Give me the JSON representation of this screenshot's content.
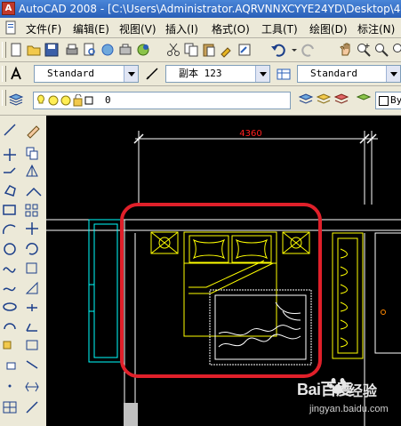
{
  "window": {
    "title": "AutoCAD 2008 - [C:\\Users\\Administrator.AQRVNNXCYYE24YD\\Desktop\\4-"
  },
  "menu": {
    "items": [
      "文件(F)",
      "编辑(E)",
      "视图(V)",
      "插入(I)",
      "格式(O)",
      "工具(T)",
      "绘图(D)",
      "标注(N)"
    ]
  },
  "styles_toolbar": {
    "text_style": "Standard",
    "dim_style": "副本 123",
    "table_style": "Standard"
  },
  "layers_toolbar": {
    "current_layer": "0",
    "color_control": "By"
  },
  "drawing": {
    "dimension_text": "4360",
    "colors": {
      "dimension": "#ff2020",
      "walls": "#ffffff",
      "furniture": "#ffff00",
      "window": "#00ffff",
      "highlight": "#e0202a"
    }
  },
  "watermark": {
    "logo": "Bai百度",
    "cn": "经验",
    "url": "jingyan.baidu.com"
  }
}
